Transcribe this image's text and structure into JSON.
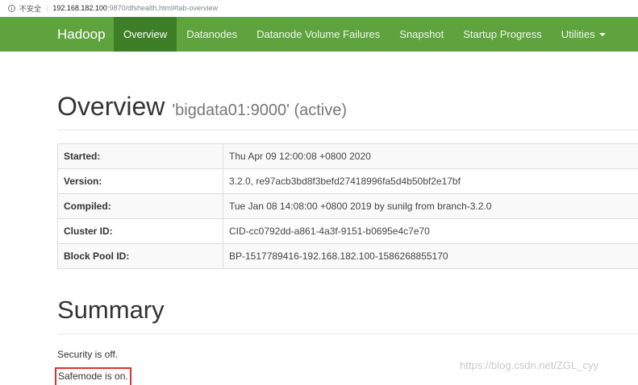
{
  "address_bar": {
    "insecure_label": "不安全",
    "host": "192.168.182.100",
    "path": ":9870/dfshealth.html#tab-overview"
  },
  "navbar": {
    "brand": "Hadoop",
    "items": [
      {
        "label": "Overview",
        "active": true
      },
      {
        "label": "Datanodes"
      },
      {
        "label": "Datanode Volume Failures"
      },
      {
        "label": "Snapshot"
      },
      {
        "label": "Startup Progress"
      },
      {
        "label": "Utilities"
      }
    ],
    "colors": {
      "bar": "#5fa33e",
      "active": "#3e7e27"
    }
  },
  "overview": {
    "title": "Overview",
    "subtitle": "'bigdata01:9000' (active)",
    "rows": [
      {
        "key": "Started:",
        "value": "Thu Apr 09 12:00:08 +0800 2020"
      },
      {
        "key": "Version:",
        "value": "3.2.0, re97acb3bd8f3befd27418996fa5d4b50bf2e17bf"
      },
      {
        "key": "Compiled:",
        "value": "Tue Jan 08 14:08:00 +0800 2019 by sunilg from branch-3.2.0"
      },
      {
        "key": "Cluster ID:",
        "value": "CID-cc0792dd-a861-4a3f-9151-b0695e4c7e70"
      },
      {
        "key": "Block Pool ID:",
        "value": "BP-1517789416-192.168.182.100-1586268855170"
      }
    ]
  },
  "summary": {
    "title": "Summary",
    "security": "Security is off.",
    "safemode": "Safemode is on."
  },
  "watermark": "https://blog.csdn.net/ZGL_cyy"
}
